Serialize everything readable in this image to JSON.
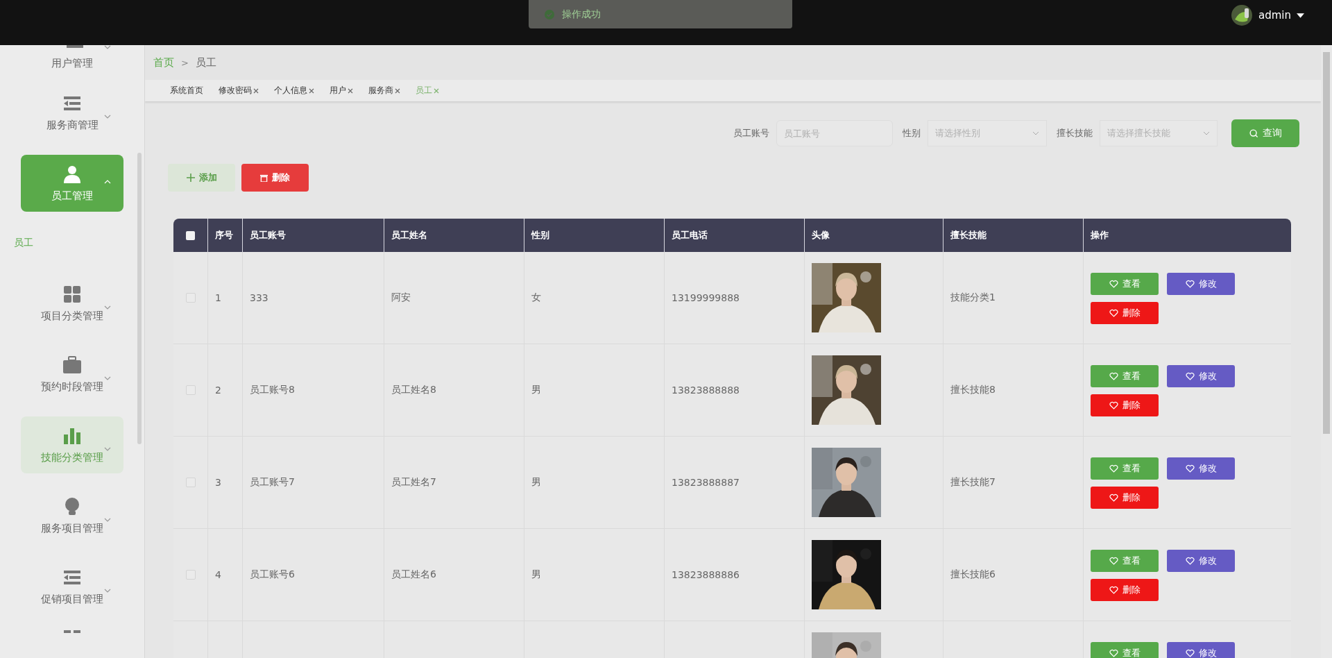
{
  "toast": {
    "message": "操作成功"
  },
  "header": {
    "username": "admin"
  },
  "sidebar": {
    "items": [
      {
        "label": "用户管理",
        "selected": false,
        "hovered": false,
        "expanded": false,
        "partial": true
      },
      {
        "label": "服务商管理",
        "selected": false,
        "hovered": false,
        "expanded": false
      },
      {
        "label": "员工管理",
        "selected": true,
        "hovered": false,
        "expanded": true,
        "children": [
          {
            "label": "员工",
            "selected": true
          }
        ]
      },
      {
        "label": "项目分类管理",
        "selected": false,
        "hovered": false,
        "expanded": false
      },
      {
        "label": "预约时段管理",
        "selected": false,
        "hovered": false,
        "expanded": false
      },
      {
        "label": "技能分类管理",
        "selected": false,
        "hovered": true,
        "expanded": false
      },
      {
        "label": "服务项目管理",
        "selected": false,
        "hovered": false,
        "expanded": false
      },
      {
        "label": "促销项目管理",
        "selected": false,
        "hovered": false,
        "expanded": false
      }
    ]
  },
  "breadcrumb": [
    {
      "label": "首页",
      "link": true
    },
    {
      "label": "员工",
      "link": false
    }
  ],
  "breadcrumb_separator": ">",
  "tabs": [
    {
      "label": "系统首页",
      "selected": false,
      "closable": false
    },
    {
      "label": "修改密码",
      "selected": false,
      "closable": true
    },
    {
      "label": "个人信息",
      "selected": false,
      "closable": true
    },
    {
      "label": "用户",
      "selected": false,
      "closable": true
    },
    {
      "label": "服务商",
      "selected": false,
      "closable": true
    },
    {
      "label": "员工",
      "selected": true,
      "closable": true
    }
  ],
  "search": {
    "fields": [
      {
        "label": "员工账号",
        "kind": "input",
        "placeholder": "员工账号"
      },
      {
        "label": "性别",
        "kind": "select",
        "placeholder": "请选择性别"
      },
      {
        "label": "擅长技能",
        "kind": "select",
        "placeholder": "请选择擅长技能"
      }
    ],
    "button": "查询"
  },
  "actions": [
    {
      "label": "添加",
      "kind": "add"
    },
    {
      "label": "删除",
      "kind": "delete"
    }
  ],
  "table": {
    "all_checked": false,
    "columns": [
      "序号",
      "员工账号",
      "员工姓名",
      "性别",
      "员工电话",
      "头像",
      "擅长技能",
      "操作"
    ],
    "rows": [
      {
        "checked": false,
        "index": "1",
        "account": "333",
        "name": "阿安",
        "gender": "女",
        "phone": "13199999888",
        "skill": "技能分类1",
        "buttons": [
          {
            "label": "查看",
            "kind": "view"
          },
          {
            "label": "修改",
            "kind": "edit"
          },
          {
            "label": "删除",
            "kind": "delete"
          }
        ]
      },
      {
        "checked": false,
        "index": "2",
        "account": "员工账号8",
        "name": "员工姓名8",
        "gender": "男",
        "phone": "13823888888",
        "skill": "擅长技能8",
        "buttons": [
          {
            "label": "查看",
            "kind": "view"
          },
          {
            "label": "修改",
            "kind": "edit"
          },
          {
            "label": "删除",
            "kind": "delete"
          }
        ]
      },
      {
        "checked": false,
        "index": "3",
        "account": "员工账号7",
        "name": "员工姓名7",
        "gender": "男",
        "phone": "13823888887",
        "skill": "擅长技能7",
        "buttons": [
          {
            "label": "查看",
            "kind": "view"
          },
          {
            "label": "修改",
            "kind": "edit"
          },
          {
            "label": "删除",
            "kind": "delete"
          }
        ]
      },
      {
        "checked": false,
        "index": "4",
        "account": "员工账号6",
        "name": "员工姓名6",
        "gender": "男",
        "phone": "13823888886",
        "skill": "擅长技能6",
        "buttons": [
          {
            "label": "查看",
            "kind": "view"
          },
          {
            "label": "修改",
            "kind": "edit"
          },
          {
            "label": "删除",
            "kind": "delete"
          }
        ]
      },
      {
        "buttons": [
          {
            "label": "查看",
            "kind": "view"
          },
          {
            "label": "修改",
            "kind": "edit"
          }
        ]
      }
    ]
  }
}
